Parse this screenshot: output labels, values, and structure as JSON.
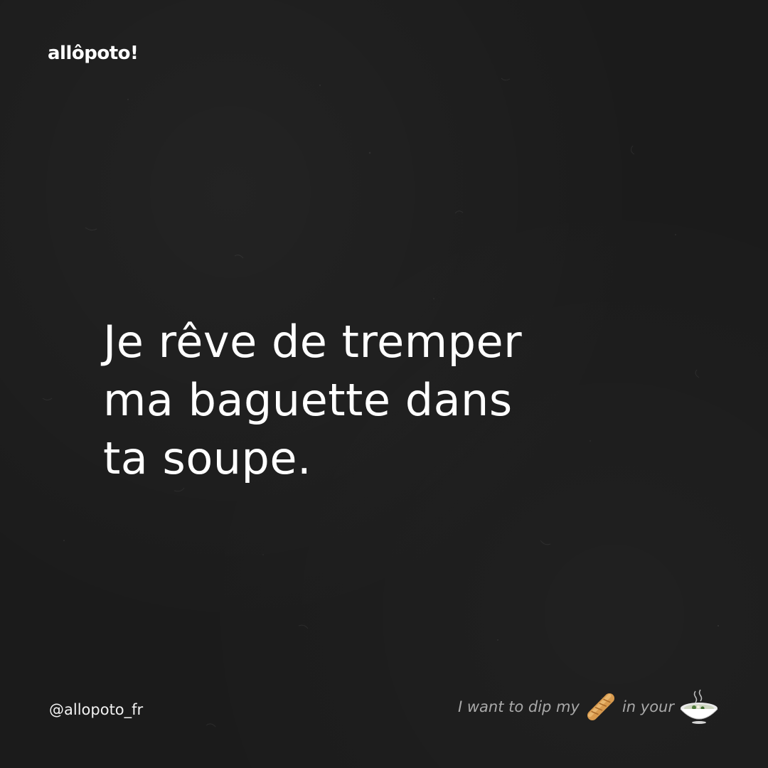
{
  "brand": {
    "logo_text": "allôpoto!",
    "handle": "@allopoto_fr"
  },
  "quote": {
    "lines": [
      "Je rêve de tremper",
      "ma baguette dans",
      "ta soupe."
    ]
  },
  "translation": {
    "part_1": "I want to dip my",
    "part_2": "in your",
    "icon_1": "baguette-icon",
    "icon_2": "soup-bowl-icon"
  },
  "colors": {
    "background": "#1b1b1b",
    "text": "#ffffff",
    "translation_text": "#a9a9a9"
  }
}
